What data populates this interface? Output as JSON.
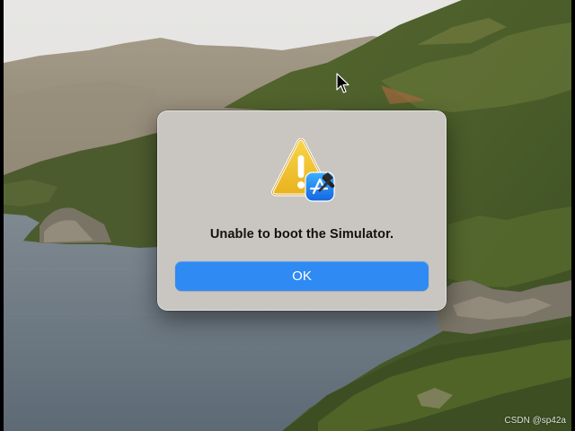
{
  "dialog": {
    "message": "Unable to boot the Simulator.",
    "ok_label": "OK",
    "icon": "warning-triangle-with-app-store-badge",
    "button_color": "#2f8af3"
  },
  "watermark": {
    "text": "CSDN @sp42a"
  },
  "wallpaper": {
    "description": "coastal mountains and sea"
  }
}
